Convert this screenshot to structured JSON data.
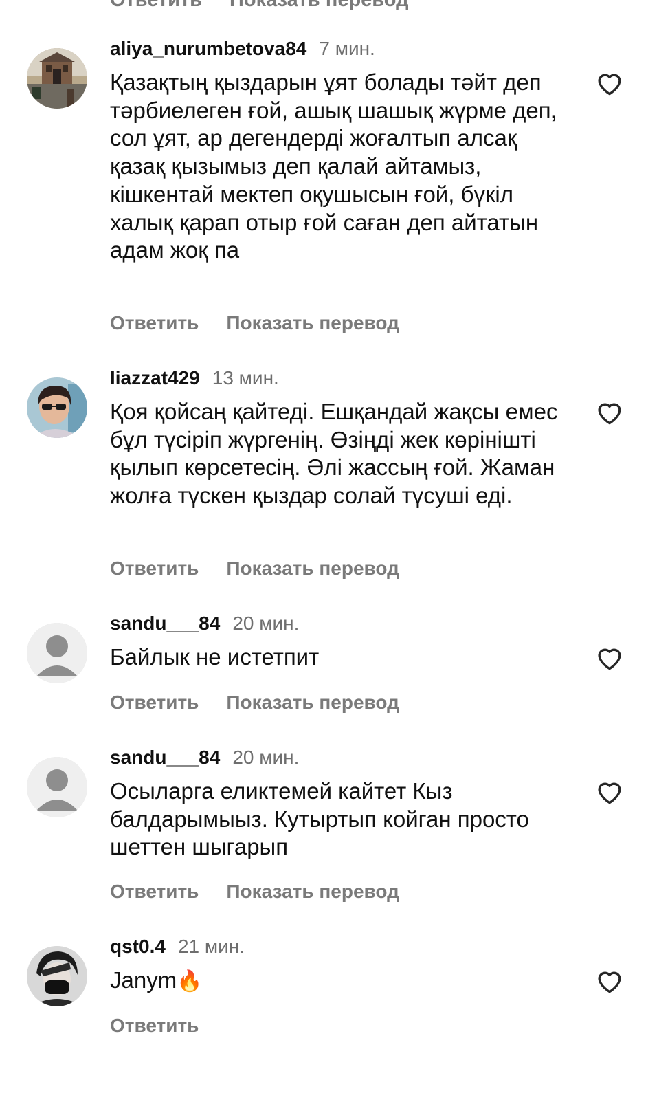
{
  "clipped_top": {
    "reply_label": "Ответить",
    "translate_label": "Показать перевод"
  },
  "comments": [
    {
      "username": "aliya_nurumbetova84",
      "time": "7 мин.",
      "text": "Қазақтың қыздарын ұят болады тәйт деп тәрбиелеген ғой, ашық шашық жүрме деп, сол ұят, ар дегендерді жоғалтып алсақ қазақ қызымыз деп қалай айтамыз, кішкентай мектеп оқушысын ғой, бүкіл халық қарап отыр ғой саған деп айтатын адам жоқ па",
      "reply_label": "Ответить",
      "translate_label": "Показать перевод",
      "avatar": "building-photo-avatar"
    },
    {
      "username": "liazzat429",
      "time": "13 мин.",
      "text": "Қоя қойсаң қайтеді. Ешқандай жақсы емес бұл түсіріп жүргенің. Өзіңді жек көрінішті қылып көрсетесің. Әлі жассың ғой. Жаман жолға түскен қыздар солай түсуші еді.",
      "reply_label": "Ответить",
      "translate_label": "Показать перевод",
      "avatar": "woman-sunglasses-avatar"
    },
    {
      "username": "sandu___84",
      "time": "20 мин.",
      "text": "Байлык не истетпит",
      "reply_label": "Ответить",
      "translate_label": "Показать перевод",
      "avatar": "default-user-avatar"
    },
    {
      "username": "sandu___84",
      "time": "20 мин.",
      "text": "Осыларга еликтемей кайтет Кыз балдарымыыз. Кутыртып койган просто шеттен шыгарып",
      "reply_label": "Ответить",
      "translate_label": "Показать перевод",
      "avatar": "default-user-avatar"
    },
    {
      "username": "qst0.4",
      "time": "21 мин.",
      "text": "Janym",
      "emoji": "🔥",
      "reply_label": "Ответить",
      "avatar": "masked-person-avatar"
    }
  ],
  "icons": {
    "like": "heart-outline-icon"
  },
  "colors": {
    "text": "#111111",
    "muted": "#7a7a7a",
    "background": "#ffffff"
  }
}
